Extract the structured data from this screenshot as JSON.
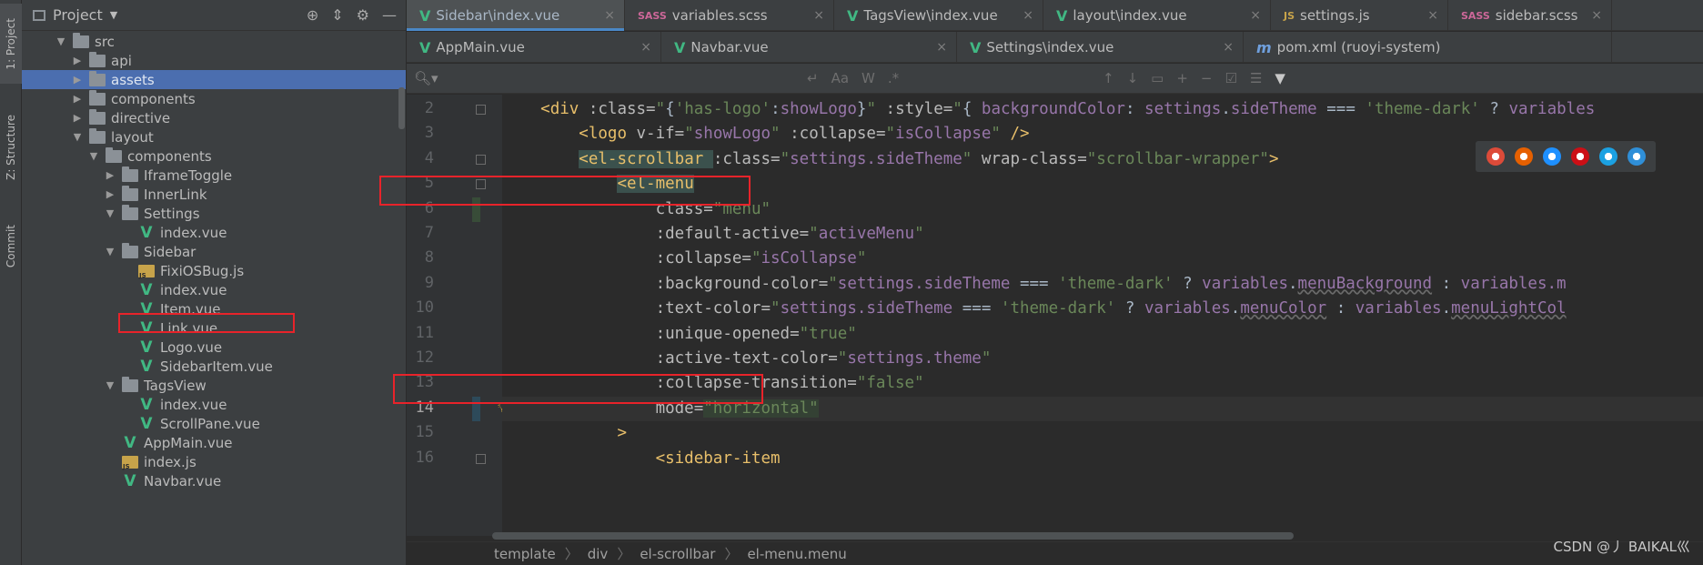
{
  "toolstrip": {
    "project": "1: Project",
    "structure": "Z: Structure",
    "commit": "Commit"
  },
  "project_panel": {
    "title": "Project",
    "tree": [
      {
        "label": "src",
        "type": "folder",
        "depth": 0,
        "expanded": true
      },
      {
        "label": "api",
        "type": "folder",
        "depth": 1,
        "expanded": false
      },
      {
        "label": "assets",
        "type": "folder",
        "depth": 1,
        "expanded": false,
        "selected": true
      },
      {
        "label": "components",
        "type": "folder",
        "depth": 1,
        "expanded": false
      },
      {
        "label": "directive",
        "type": "folder",
        "depth": 1,
        "expanded": false
      },
      {
        "label": "layout",
        "type": "folder",
        "depth": 1,
        "expanded": true
      },
      {
        "label": "components",
        "type": "folder",
        "depth": 2,
        "expanded": true
      },
      {
        "label": "IframeToggle",
        "type": "folder",
        "depth": 3,
        "expanded": false
      },
      {
        "label": "InnerLink",
        "type": "folder",
        "depth": 3,
        "expanded": false
      },
      {
        "label": "Settings",
        "type": "folder",
        "depth": 3,
        "expanded": true
      },
      {
        "label": "index.vue",
        "type": "vue",
        "depth": 4
      },
      {
        "label": "Sidebar",
        "type": "folder",
        "depth": 3,
        "expanded": true
      },
      {
        "label": "FixiOSBug.js",
        "type": "js",
        "depth": 4
      },
      {
        "label": "index.vue",
        "type": "vue",
        "depth": 4
      },
      {
        "label": "Item.vue",
        "type": "vue",
        "depth": 4
      },
      {
        "label": "Link.vue",
        "type": "vue",
        "depth": 4
      },
      {
        "label": "Logo.vue",
        "type": "vue",
        "depth": 4
      },
      {
        "label": "SidebarItem.vue",
        "type": "vue",
        "depth": 4
      },
      {
        "label": "TagsView",
        "type": "folder",
        "depth": 3,
        "expanded": true
      },
      {
        "label": "index.vue",
        "type": "vue",
        "depth": 4
      },
      {
        "label": "ScrollPane.vue",
        "type": "vue",
        "depth": 4
      },
      {
        "label": "AppMain.vue",
        "type": "vue",
        "depth": 3
      },
      {
        "label": "index.js",
        "type": "js",
        "depth": 3
      },
      {
        "label": "Navbar.vue",
        "type": "vue",
        "depth": 3
      }
    ]
  },
  "tabs_row1": [
    {
      "label": "Sidebar\\index.vue",
      "icon": "vue",
      "active": true
    },
    {
      "label": "variables.scss",
      "icon": "sass"
    },
    {
      "label": "TagsView\\index.vue",
      "icon": "vue"
    },
    {
      "label": "layout\\index.vue",
      "icon": "vue"
    },
    {
      "label": "settings.js",
      "icon": "js"
    },
    {
      "label": "sidebar.scss",
      "icon": "sass"
    }
  ],
  "tabs_row2": [
    {
      "label": "AppMain.vue",
      "icon": "vue"
    },
    {
      "label": "Navbar.vue",
      "icon": "vue"
    },
    {
      "label": "Settings\\index.vue",
      "icon": "vue"
    },
    {
      "label": "pom.xml (ruoyi-system)",
      "icon": "maven"
    }
  ],
  "code_lines": [
    {
      "n": "2",
      "parts": [
        [
          "pl",
          "    "
        ],
        [
          "tg",
          "<div "
        ],
        [
          "at",
          ":class="
        ],
        [
          "st",
          "\""
        ],
        [
          "pl",
          "{"
        ],
        [
          "st",
          "'has-logo'"
        ],
        [
          "pl",
          ":"
        ],
        [
          "vb",
          "showLogo"
        ],
        [
          "pl",
          "}"
        ],
        [
          "st",
          "\""
        ],
        [
          "at",
          " :style="
        ],
        [
          "st",
          "\""
        ],
        [
          "pl",
          "{ "
        ],
        [
          "vb",
          "backgroundColor"
        ],
        [
          "pl",
          ": "
        ],
        [
          "vb",
          "settings"
        ],
        [
          "pl",
          "."
        ],
        [
          "vb",
          "sideTheme"
        ],
        [
          "pl",
          " === "
        ],
        [
          "st",
          "'theme-dark'"
        ],
        [
          "pl",
          " ? "
        ],
        [
          "vb",
          "variables"
        ]
      ]
    },
    {
      "n": "3",
      "parts": [
        [
          "pl",
          "        "
        ],
        [
          "tg",
          "<logo "
        ],
        [
          "at",
          "v-if="
        ],
        [
          "st",
          "\""
        ],
        [
          "vb",
          "showLogo"
        ],
        [
          "st",
          "\""
        ],
        [
          "at",
          " :collapse="
        ],
        [
          "st",
          "\""
        ],
        [
          "vb",
          "isCollapse"
        ],
        [
          "st",
          "\""
        ],
        [
          "tg",
          " />"
        ]
      ]
    },
    {
      "n": "4",
      "parts": [
        [
          "pl",
          "        "
        ],
        [
          "tg",
          "<el-scrollbar "
        ],
        [
          "at",
          ":class="
        ],
        [
          "st",
          "\""
        ],
        [
          "vb",
          "settings.sideTheme"
        ],
        [
          "st",
          "\""
        ],
        [
          "at",
          " wrap-class="
        ],
        [
          "st",
          "\"scrollbar-wrapper\""
        ],
        [
          "tg",
          ">"
        ]
      ]
    },
    {
      "n": "5",
      "parts": [
        [
          "pl",
          "            "
        ],
        [
          "tg",
          "<el-menu"
        ]
      ]
    },
    {
      "n": "6",
      "parts": [
        [
          "pl",
          "                "
        ],
        [
          "at",
          "class="
        ],
        [
          "st",
          "\"menu\""
        ]
      ]
    },
    {
      "n": "7",
      "parts": [
        [
          "pl",
          "                "
        ],
        [
          "at",
          ":default-active="
        ],
        [
          "st",
          "\""
        ],
        [
          "vb",
          "activeMenu"
        ],
        [
          "st",
          "\""
        ]
      ]
    },
    {
      "n": "8",
      "parts": [
        [
          "pl",
          "                "
        ],
        [
          "at",
          ":collapse="
        ],
        [
          "st",
          "\""
        ],
        [
          "vb",
          "isCollapse"
        ],
        [
          "st",
          "\""
        ]
      ]
    },
    {
      "n": "9",
      "parts": [
        [
          "pl",
          "                "
        ],
        [
          "at",
          ":background-color="
        ],
        [
          "st",
          "\""
        ],
        [
          "vb",
          "settings.sideTheme"
        ],
        [
          "pl",
          " === "
        ],
        [
          "st",
          "'theme-dark'"
        ],
        [
          "pl",
          " ? "
        ],
        [
          "vb",
          "variables"
        ],
        [
          "pl",
          "."
        ],
        [
          "vb",
          "menuBackground"
        ],
        [
          "pl",
          " : "
        ],
        [
          "vb",
          "variables.m"
        ]
      ]
    },
    {
      "n": "10",
      "parts": [
        [
          "pl",
          "                "
        ],
        [
          "at",
          ":text-color="
        ],
        [
          "st",
          "\""
        ],
        [
          "vb",
          "settings.sideTheme"
        ],
        [
          "pl",
          " === "
        ],
        [
          "st",
          "'theme-dark'"
        ],
        [
          "pl",
          " ? "
        ],
        [
          "vb",
          "variables"
        ],
        [
          "pl",
          "."
        ],
        [
          "vb",
          "menuColor"
        ],
        [
          "pl",
          " : "
        ],
        [
          "vb",
          "variables"
        ],
        [
          "pl",
          "."
        ],
        [
          "vb",
          "menuLightCol"
        ]
      ]
    },
    {
      "n": "11",
      "parts": [
        [
          "pl",
          "                "
        ],
        [
          "at",
          ":unique-opened="
        ],
        [
          "st",
          "\"true\""
        ]
      ]
    },
    {
      "n": "12",
      "parts": [
        [
          "pl",
          "                "
        ],
        [
          "at",
          ":active-text-color="
        ],
        [
          "st",
          "\""
        ],
        [
          "vb",
          "settings.theme"
        ],
        [
          "st",
          "\""
        ]
      ]
    },
    {
      "n": "13",
      "parts": [
        [
          "pl",
          "                "
        ],
        [
          "at",
          ":collapse-transition="
        ],
        [
          "st",
          "\"false\""
        ]
      ]
    },
    {
      "n": "14",
      "parts": [
        [
          "pl",
          "                "
        ],
        [
          "at",
          "mode="
        ],
        [
          "st",
          "\"horizontal\""
        ]
      ]
    },
    {
      "n": "15",
      "parts": [
        [
          "pl",
          "            "
        ],
        [
          "tg",
          ">"
        ]
      ]
    },
    {
      "n": "16",
      "parts": [
        [
          "pl",
          "                "
        ],
        [
          "tg",
          "<sidebar-item"
        ]
      ]
    }
  ],
  "breadcrumb": [
    "template",
    "div",
    "el-scrollbar",
    "el-menu.menu"
  ],
  "watermark": "CSDN @丿 BAIKAL巛",
  "colors": {
    "selection": "#4b6eaf",
    "highlight_box": "#e8232a",
    "tab_underline": "#4a88c7"
  },
  "browser_icons": [
    "chrome-icon",
    "firefox-icon",
    "safari-icon",
    "opera-icon",
    "ie-icon",
    "edge-icon"
  ]
}
